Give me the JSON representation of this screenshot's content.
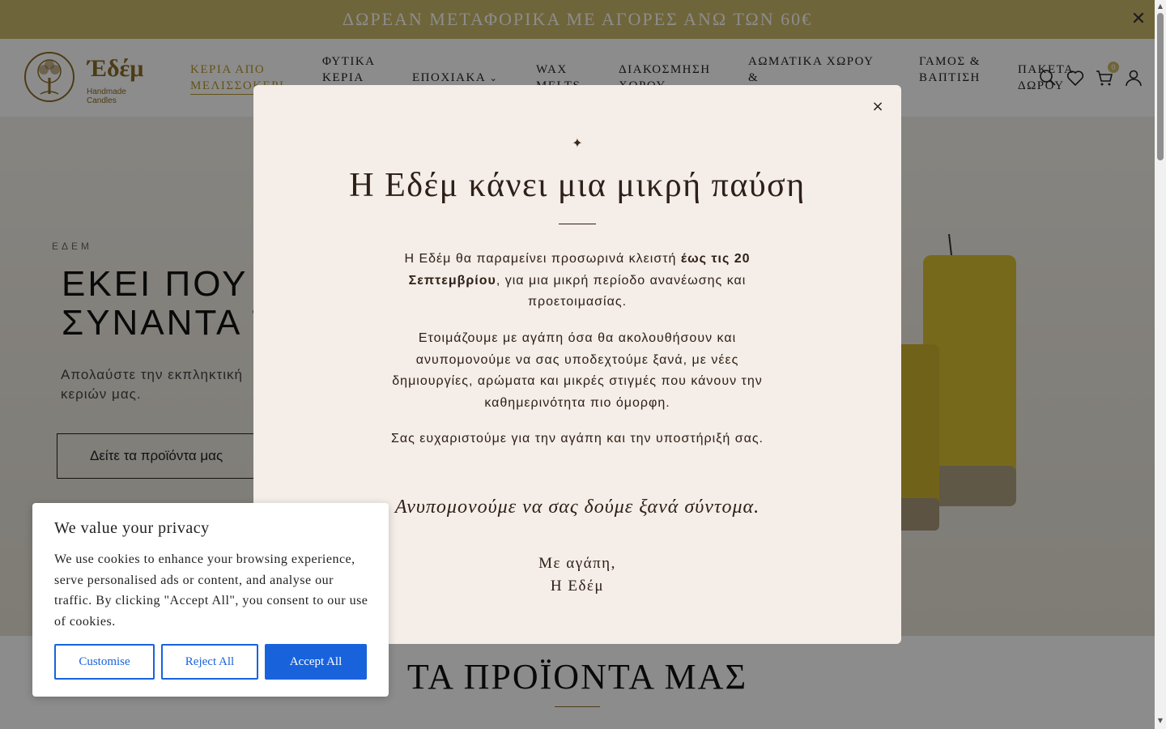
{
  "announcement": {
    "text": "ΔΩΡΕΑΝ ΜΕΤΑΦΟΡΙΚΑ ΜΕ ΑΓΟΡΕΣ ΑΝΩ ΤΩΝ 60€",
    "close_icon": "close-icon"
  },
  "header": {
    "logo_name": "Έδέμ",
    "logo_sub": "Handmade Candles",
    "nav": [
      {
        "label": "ΚΕΡΙΑ ΑΠΟ ΜΕΛΙΣΣΟΚΕΡΙ",
        "active": true
      },
      {
        "label": "ΦΥΤΙΚΑ ΚΕΡΙΑ"
      },
      {
        "label": "ΕΠΟΧΙΑΚΑ",
        "has_dropdown": true
      },
      {
        "label": "WAX MELTS"
      },
      {
        "label": "ΔΙΑΚΟΣΜΗΣΗ ΧΩΡΟΥ"
      },
      {
        "label": "ΑΩΜΑΤΙΚΑ ΧΩΡΟΥ &"
      },
      {
        "label": "ΓΑΜΟΣ & ΒΑΠΤΙΣΗ"
      },
      {
        "label": "ΠΑΚΕΤΑ ΔΩΡΟΥ"
      }
    ],
    "cart_count": "0",
    "icons": [
      "search-icon",
      "heart-icon",
      "cart-icon",
      "user-icon"
    ],
    "accent": "#b8962d"
  },
  "hero": {
    "eyebrow": "ΕΔΕΜ",
    "title_line1": "ΕΚΕΙ ΠΟΥ Η",
    "title_line2": "ΣΥΝΑΝΤΑ Τ",
    "description": "Απολαύστε την εκπληκτική",
    "description_line2": "κεριών μας.",
    "button": "Δείτε τα προϊόντα μας"
  },
  "products": {
    "title": "ΤΑ ΠΡΟΪΟΝΤΑ ΜΑΣ"
  },
  "modal": {
    "star": "✦",
    "title": "Η Εδέμ κάνει μια μικρή παύση",
    "p1_before": "Η Εδέμ θα παραμείνει προσωρινά κλειστή ",
    "p1_bold": "έως τις 20 Σεπτεμβρίου",
    "p1_after": ", για μια μικρή περίοδο ανανέωσης και προετοιμασίας.",
    "p2": "Ετοιμάζουμε με αγάπη όσα θα ακολουθήσουν και ανυπομονούμε να σας υποδεχτούμε ξανά, με νέες δημιουργίες, αρώματα και μικρές στιγμές που κάνουν την καθημερινότητα πιο όμορφη.",
    "p3": "Σας ευχαριστούμε για την αγάπη και την υποστήριξή σας.",
    "italic": "Ανυπομονούμε να σας δούμε ξανά σύντομα.",
    "sign1": "Με αγάπη,",
    "sign2": "Η Εδέμ",
    "close": "×",
    "background": "#f5ede7"
  },
  "cookie": {
    "title": "We value your privacy",
    "text": "We use cookies to enhance your browsing experience, serve personalised ads or content, and analyse our traffic. By clicking \"Accept All\", you consent to our use of cookies.",
    "customise": "Customise",
    "reject": "Reject All",
    "accept": "Accept All",
    "accent": "#1863dc"
  }
}
